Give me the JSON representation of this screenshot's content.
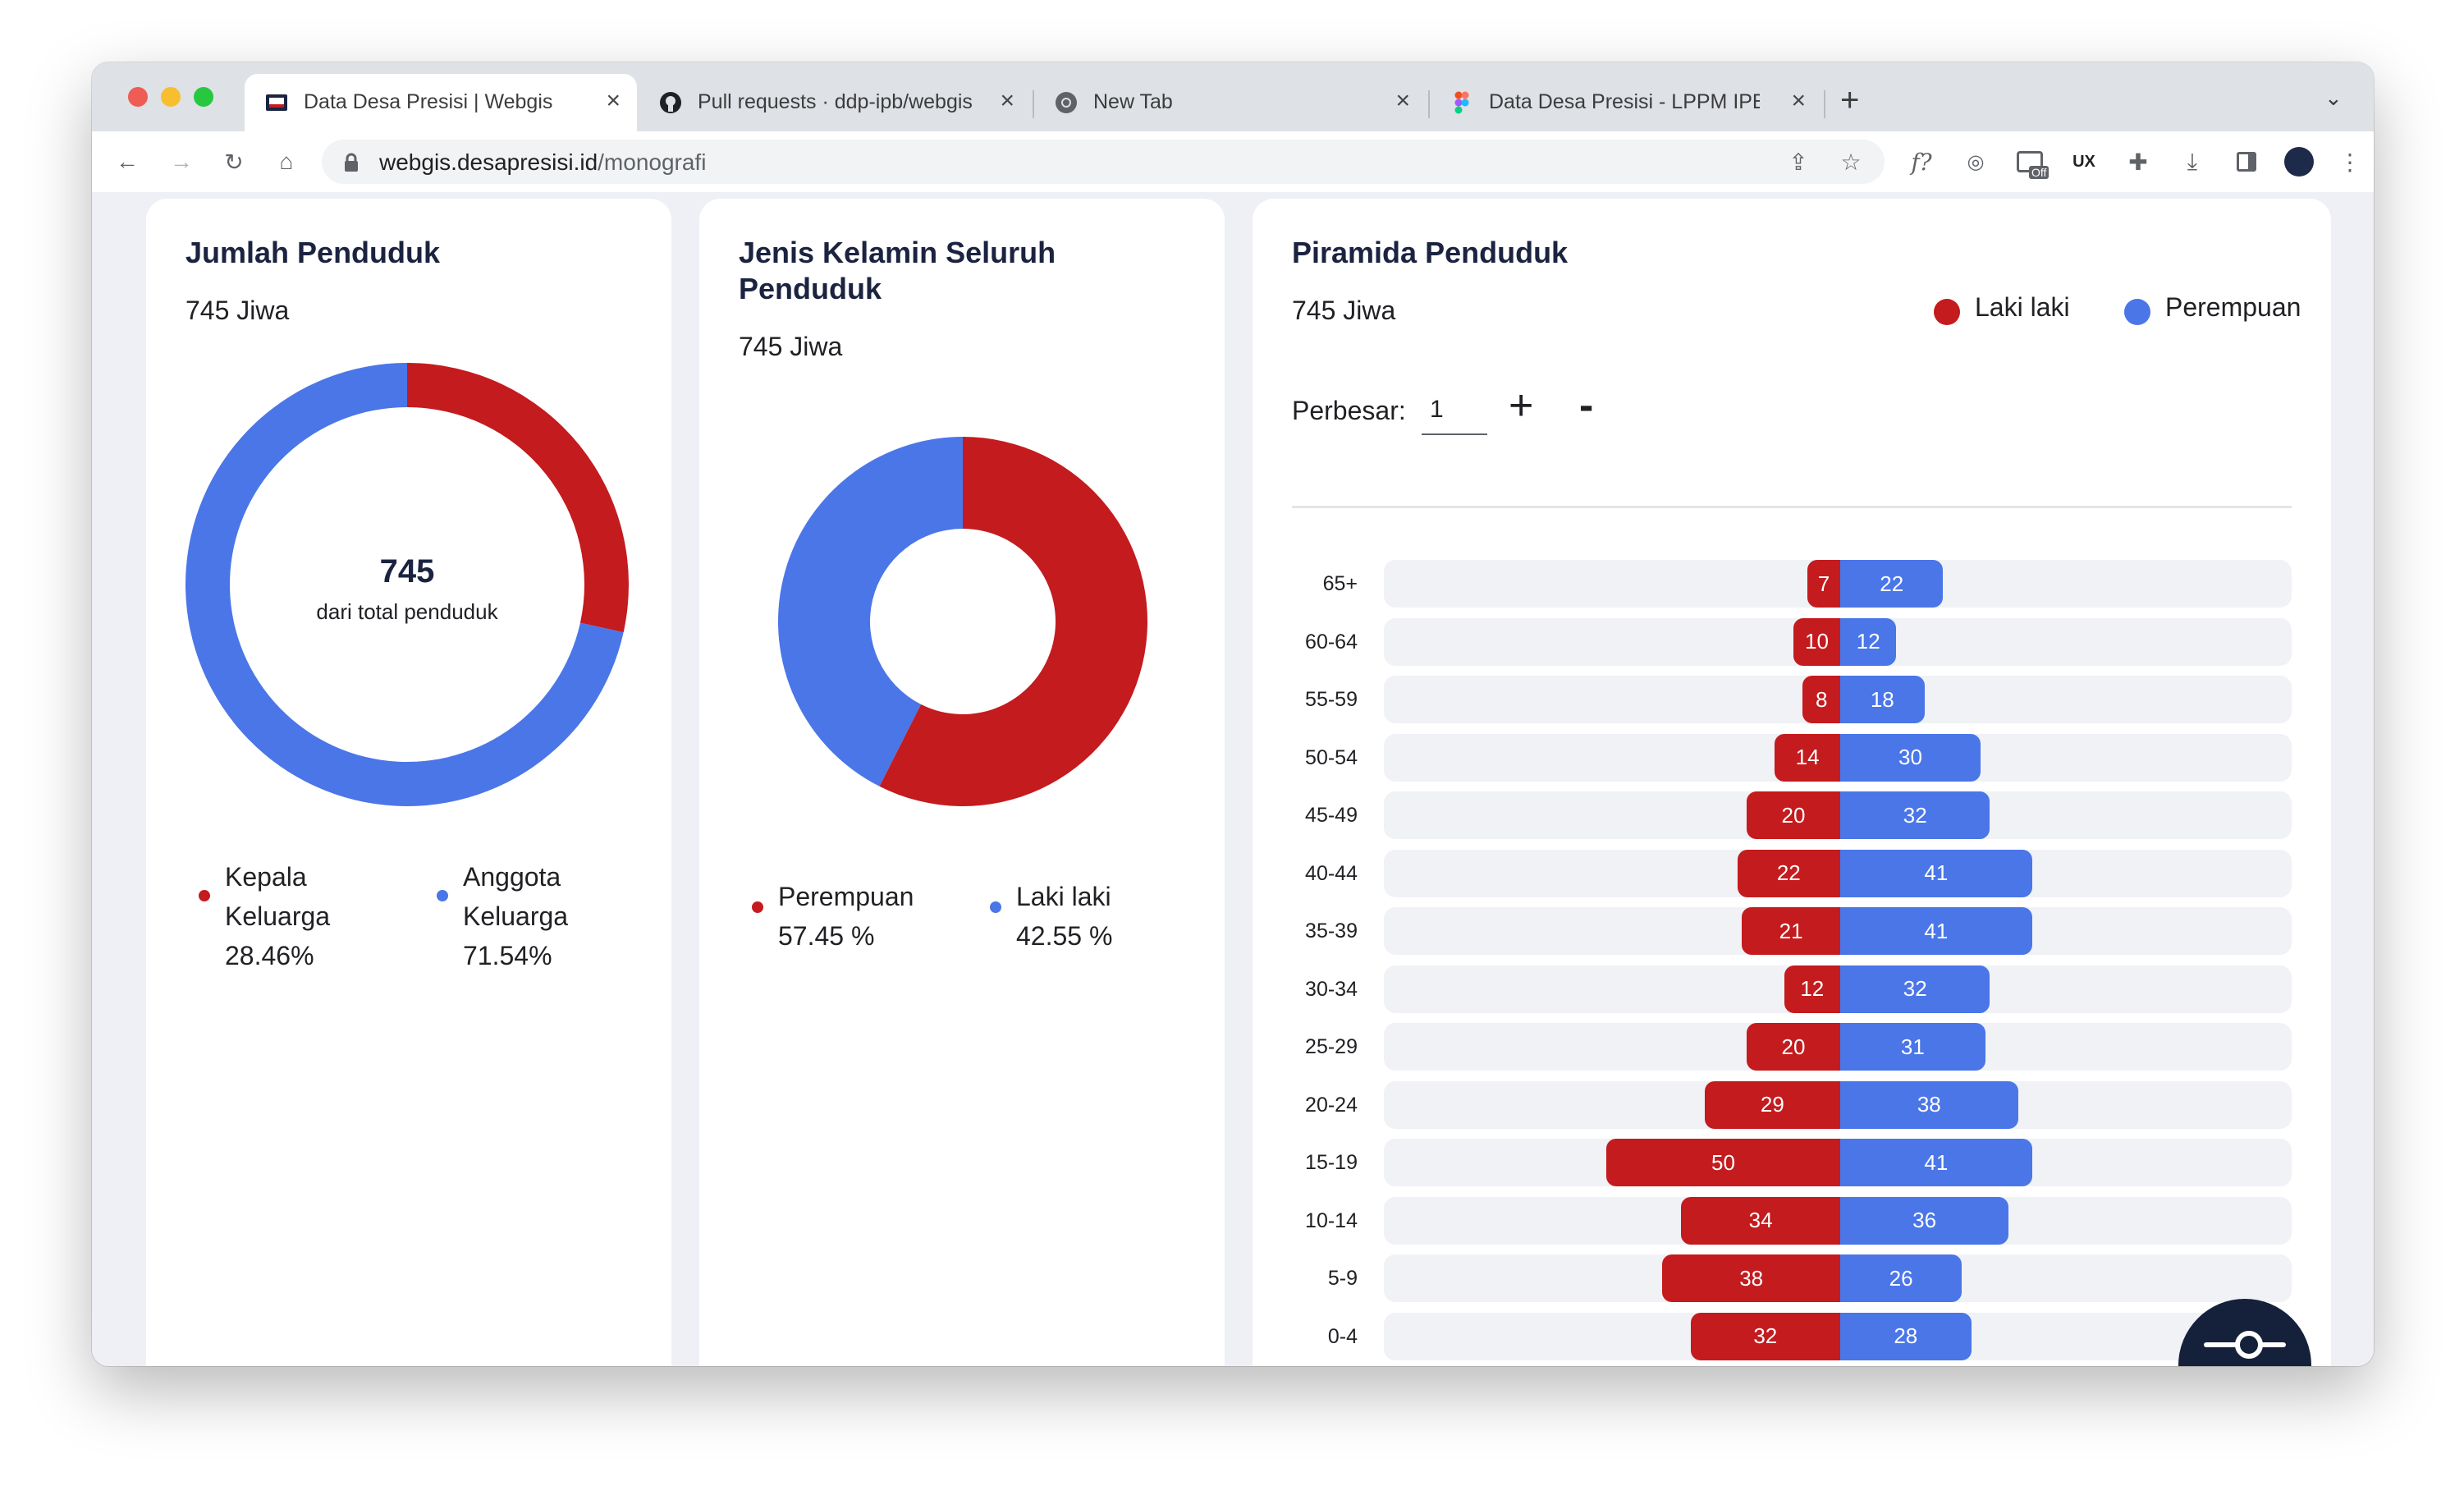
{
  "browser": {
    "tabs": [
      {
        "title": "Data Desa Presisi | Webgis",
        "active": true,
        "icon": "webgis-favicon"
      },
      {
        "title": "Pull requests · ddp-ipb/webgis",
        "active": false,
        "icon": "github-icon"
      },
      {
        "title": "New Tab",
        "active": false,
        "icon": "chrome-icon"
      },
      {
        "title": "Data Desa Presisi - LPPM IPB",
        "active": false,
        "icon": "figma-icon"
      }
    ],
    "url_host": "webgis.desapresisi.id",
    "url_path": "/monografi",
    "extension_badge": "Off",
    "extension_ux_label": "UX",
    "extension_f_label": "f?"
  },
  "colors": {
    "red": "#c41b1e",
    "blue": "#4a76e8",
    "navy": "#1b2340"
  },
  "card1": {
    "title": "Jumlah Penduduk",
    "subtitle": "745 Jiwa",
    "center_value": "745",
    "center_label": "dari total penduduk",
    "legend": [
      {
        "label_line1": "Kepala",
        "label_line2": "Keluarga",
        "percent": "28.46%",
        "color": "#c41b1e"
      },
      {
        "label_line1": "Anggota",
        "label_line2": "Keluarga",
        "percent": "71.54%",
        "color": "#4a76e8"
      }
    ]
  },
  "card2": {
    "title_line1": "Jenis Kelamin Seluruh",
    "title_line2": "Penduduk",
    "subtitle": "745 Jiwa",
    "legend": [
      {
        "label": "Perempuan",
        "percent": "57.45 %",
        "color": "#c41b1e"
      },
      {
        "label": "Laki laki",
        "percent": "42.55 %",
        "color": "#4a76e8"
      }
    ]
  },
  "card3": {
    "title": "Piramida Penduduk",
    "subtitle": "745 Jiwa",
    "legend_male": "Laki laki",
    "legend_female": "Perempuan",
    "zoom_label": "Perbesar:",
    "zoom_value": "1",
    "plus_label": "+",
    "minus_label": "-"
  },
  "chart_data": [
    {
      "type": "pie",
      "title": "Jumlah Penduduk",
      "categories": [
        "Kepala Keluarga",
        "Anggota Keluarga"
      ],
      "values": [
        28.46,
        71.54
      ]
    },
    {
      "type": "pie",
      "title": "Jenis Kelamin Seluruh Penduduk",
      "categories": [
        "Perempuan",
        "Laki laki"
      ],
      "values": [
        57.45,
        42.55
      ]
    },
    {
      "type": "bar",
      "title": "Piramida Penduduk",
      "categories": [
        "65+",
        "60-64",
        "55-59",
        "50-54",
        "45-49",
        "40-44",
        "35-39",
        "30-34",
        "25-29",
        "20-24",
        "15-19",
        "10-14",
        "5-9",
        "0-4"
      ],
      "series": [
        {
          "name": "Laki laki",
          "values": [
            7,
            10,
            8,
            14,
            20,
            22,
            21,
            12,
            20,
            29,
            50,
            34,
            38,
            32
          ]
        },
        {
          "name": "Perempuan",
          "values": [
            22,
            12,
            18,
            30,
            32,
            41,
            41,
            32,
            31,
            38,
            41,
            36,
            26,
            28
          ]
        }
      ]
    }
  ]
}
